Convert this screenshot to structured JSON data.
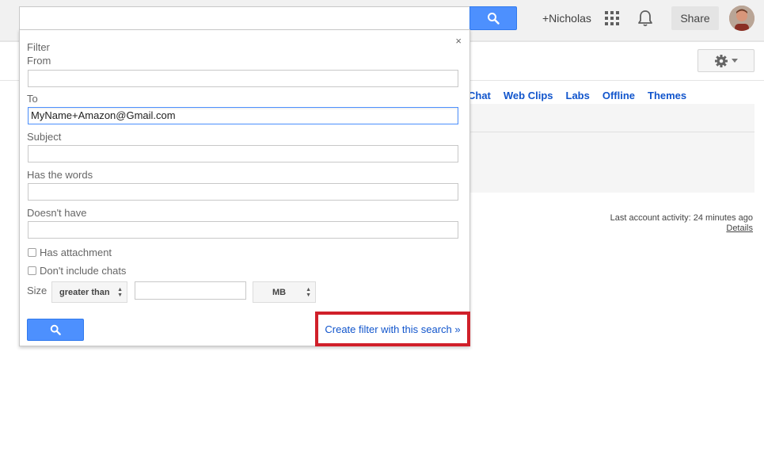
{
  "header": {
    "search_value": "",
    "plus_name": "+Nicholas",
    "share_label": "Share"
  },
  "settings_tabs": [
    "Chat",
    "Web Clips",
    "Labs",
    "Offline",
    "Themes"
  ],
  "account": {
    "last_activity": "Last account activity: 24 minutes ago",
    "details_link": "Details"
  },
  "filter": {
    "title": "Filter",
    "close": "×",
    "fields": {
      "from": {
        "label": "From",
        "value": ""
      },
      "to": {
        "label": "To",
        "value": "MyName+Amazon@Gmail.com"
      },
      "subject": {
        "label": "Subject",
        "value": ""
      },
      "has_words": {
        "label": "Has the words",
        "value": ""
      },
      "doesnt_have": {
        "label": "Doesn't have",
        "value": ""
      }
    },
    "has_attachment": "Has attachment",
    "dont_include_chats": "Don't include chats",
    "size_label": "Size",
    "size_operator": "greater than",
    "size_value": "",
    "size_unit": "MB",
    "create_filter_link": "Create filter with this search »"
  },
  "colors": {
    "accent_blue": "#4d90fe",
    "link_blue": "#1155cc",
    "highlight_red": "#d0202a"
  }
}
